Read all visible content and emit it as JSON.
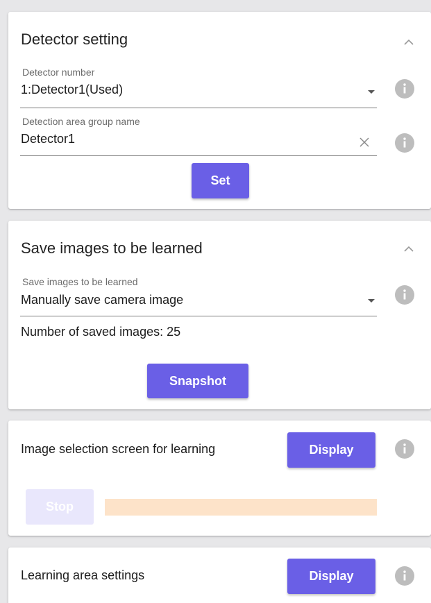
{
  "detector_setting": {
    "title": "Detector setting",
    "detector_number_label": "Detector number",
    "detector_number_value": "1:Detector1(Used)",
    "group_name_label": "Detection area group name",
    "group_name_value": "Detector1",
    "set_button": "Set"
  },
  "save_images": {
    "title": "Save images to be learned",
    "field_label": "Save images to be learned",
    "field_value": "Manually save camera image",
    "saved_count_text": "Number of saved images: 25",
    "snapshot_button": "Snapshot"
  },
  "image_selection": {
    "label": "Image selection screen for learning",
    "display_button": "Display",
    "stop_button": "Stop",
    "progress_fraction": 0
  },
  "learning_area": {
    "label": "Learning area settings",
    "display_button": "Display"
  },
  "colors": {
    "accent": "#6a5fe6",
    "accent_disabled": "#e9e7fc",
    "progress_track": "#fde3c9",
    "info_icon": "#bdbdbd",
    "background": "#e7e7e9"
  },
  "icons": {
    "collapse": "chevron-up-icon",
    "info": "info-icon",
    "dropdown": "caret-down-icon",
    "clear": "close-icon"
  }
}
